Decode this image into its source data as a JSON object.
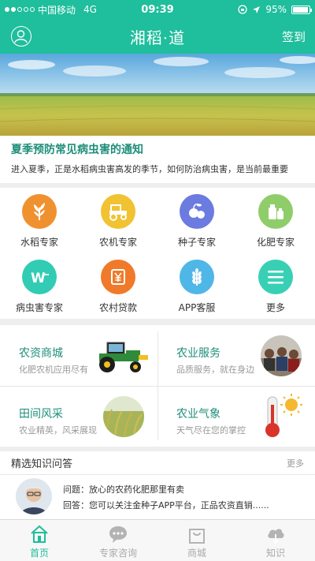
{
  "status_bar": {
    "carrier": "中国移动",
    "network": "4G",
    "time": "09:39",
    "battery": "95%",
    "battery_level": 0.95
  },
  "nav": {
    "title": "湘稻·道",
    "right_label": "签到"
  },
  "notice": {
    "title": "夏季预防常见病虫害的通知",
    "description": "进入夏季，正是水稻病虫害高发的季节，如何防治病虫害，是当前最重要"
  },
  "grid": {
    "items": [
      {
        "label": "水稻专家",
        "icon": "rice-icon",
        "color": "#f0912f"
      },
      {
        "label": "农机专家",
        "icon": "tractor-icon",
        "color": "#f1c232"
      },
      {
        "label": "种子专家",
        "icon": "seed-fruit-icon",
        "color": "#6b7be0"
      },
      {
        "label": "化肥专家",
        "icon": "fertilizer-bottle-icon",
        "color": "#8fcd6a"
      },
      {
        "label": "病虫害专家",
        "icon": "sprayer-icon",
        "color": "#31ccb3"
      },
      {
        "label": "农村贷款",
        "icon": "loan-yen-icon",
        "color": "#f07a2a"
      },
      {
        "label": "APP客服",
        "icon": "wheat-icon",
        "color": "#4fb6e8"
      },
      {
        "label": "更多",
        "icon": "menu-icon",
        "color": "#38d0b5"
      }
    ]
  },
  "services": {
    "items": [
      {
        "title": "农资商城",
        "subtitle": "化肥农机应用尽有",
        "image": "tractor-image"
      },
      {
        "title": "农业服务",
        "subtitle": "品质服务，就在身边",
        "image": "people-service-image"
      },
      {
        "title": "田间风采",
        "subtitle": "农业精英，风采展现",
        "image": "rice-field-image"
      },
      {
        "title": "农业气象",
        "subtitle": "天气尽在您的掌控",
        "image": "thermometer-sun-image"
      }
    ]
  },
  "qa": {
    "header": "精选知识问答",
    "more": "更多",
    "question": "问题：放心的农药化肥那里有卖",
    "answer": "回答：您可以关注金种子APP平台，正品农资直销......"
  },
  "tabs": [
    {
      "label": "首页",
      "icon": "home-icon",
      "active": true
    },
    {
      "label": "专家咨询",
      "icon": "chat-icon",
      "active": false
    },
    {
      "label": "商城",
      "icon": "shopping-bag-icon",
      "active": false
    },
    {
      "label": "知识",
      "icon": "cloud-knowledge-icon",
      "active": false
    }
  ],
  "colors": {
    "brand": "#1fbe9c",
    "accent_text": "#1e8e7a"
  }
}
